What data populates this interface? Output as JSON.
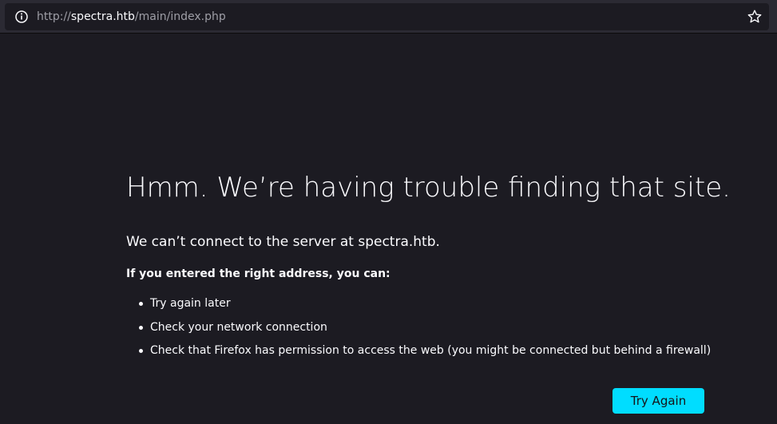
{
  "urlbar": {
    "scheme": "http://",
    "host": "spectra.htb",
    "path": "/main/index.php",
    "info_icon": "info-icon",
    "bookmark_icon": "star-icon"
  },
  "error": {
    "title": "Hmm. We’re having trouble finding that site.",
    "description": "We can’t connect to the server at spectra.htb.",
    "subhead": "If you entered the right address, you can:",
    "suggestions": [
      "Try again later",
      "Check your network connection",
      "Check that Firefox has permission to access the web (you might be connected but behind a firewall)"
    ],
    "try_again_label": "Try Again"
  },
  "colors": {
    "background": "#1c1b22",
    "toolbar": "#2b2a33",
    "text": "#fbfbfe",
    "accent_button": "#00ddff"
  }
}
